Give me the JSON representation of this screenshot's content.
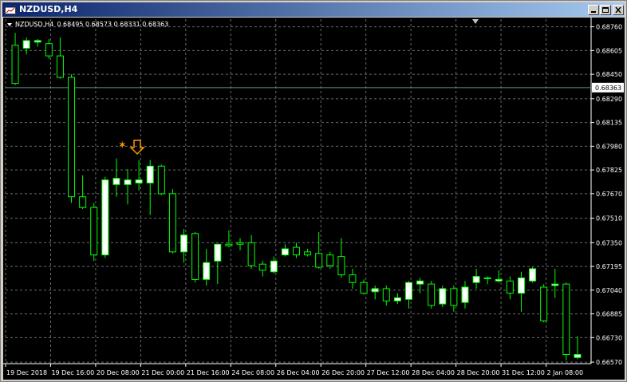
{
  "window": {
    "title": "NZDUSD,H4",
    "buttons": [
      "minimize",
      "restore",
      "close"
    ]
  },
  "header": {
    "symbol_timeframe": "NZDUSD,H4",
    "ohlc": "0.68495 0.68573 0.68331 0.68363"
  },
  "colors": {
    "background": "#000000",
    "grid": "#6b6b6b",
    "candle_up": "#ffffff",
    "candle_down": "#000000",
    "wick": "#00ff00",
    "price_line": "#5f8f8f",
    "arrow": "#ff9900",
    "axis_text": "#ffffff"
  },
  "chart_data": {
    "type": "candlestick",
    "symbol": "NZDUSD",
    "timeframe": "H4",
    "y_ticks": [
      "0.68760",
      "0.68605",
      "0.68450",
      "0.68290",
      "0.68135",
      "0.67980",
      "0.67825",
      "0.67670",
      "0.67510",
      "0.67350",
      "0.67195",
      "0.67040",
      "0.66885",
      "0.66730",
      "0.66570"
    ],
    "ylim": [
      0.6656,
      0.6881
    ],
    "current_price": "0.68363",
    "x_labels": [
      "19 Dec 2018",
      "19 Dec 16:00",
      "20 Dec 08:00",
      "21 Dec 00:00",
      "21 Dec 16:00",
      "24 Dec 08:00",
      "26 Dec 04:00",
      "26 Dec 20:00",
      "27 Dec 12:00",
      "28 Dec 04:00",
      "28 Dec 20:00",
      "31 Dec 12:00",
      "2 Jan 08:00"
    ],
    "candles": [
      {
        "o": 0.6864,
        "h": 0.6872,
        "l": 0.6838,
        "c": 0.6839
      },
      {
        "o": 0.6862,
        "h": 0.6869,
        "l": 0.6858,
        "c": 0.6867
      },
      {
        "o": 0.6866,
        "h": 0.6868,
        "l": 0.6863,
        "c": 0.6867
      },
      {
        "o": 0.6865,
        "h": 0.6868,
        "l": 0.6855,
        "c": 0.6857
      },
      {
        "o": 0.6857,
        "h": 0.6869,
        "l": 0.6842,
        "c": 0.6843
      },
      {
        "o": 0.6843,
        "h": 0.6845,
        "l": 0.6761,
        "c": 0.6765
      },
      {
        "o": 0.6765,
        "h": 0.6779,
        "l": 0.6757,
        "c": 0.6758
      },
      {
        "o": 0.6758,
        "h": 0.6761,
        "l": 0.6723,
        "c": 0.6727
      },
      {
        "o": 0.6727,
        "h": 0.6778,
        "l": 0.6725,
        "c": 0.6776
      },
      {
        "o": 0.6773,
        "h": 0.679,
        "l": 0.6765,
        "c": 0.6777
      },
      {
        "o": 0.6773,
        "h": 0.6783,
        "l": 0.676,
        "c": 0.6776
      },
      {
        "o": 0.6774,
        "h": 0.6789,
        "l": 0.6769,
        "c": 0.6776
      },
      {
        "o": 0.6774,
        "h": 0.6789,
        "l": 0.6753,
        "c": 0.6785
      },
      {
        "o": 0.6785,
        "h": 0.6786,
        "l": 0.6766,
        "c": 0.6767
      },
      {
        "o": 0.6767,
        "h": 0.677,
        "l": 0.6728,
        "c": 0.6729
      },
      {
        "o": 0.6729,
        "h": 0.6744,
        "l": 0.6722,
        "c": 0.674
      },
      {
        "o": 0.6741,
        "h": 0.6742,
        "l": 0.6709,
        "c": 0.6711
      },
      {
        "o": 0.6711,
        "h": 0.6731,
        "l": 0.6707,
        "c": 0.6722
      },
      {
        "o": 0.6723,
        "h": 0.6734,
        "l": 0.6708,
        "c": 0.6734
      },
      {
        "o": 0.6734,
        "h": 0.6743,
        "l": 0.6732,
        "c": 0.6733
      },
      {
        "o": 0.6735,
        "h": 0.6738,
        "l": 0.673,
        "c": 0.6734
      },
      {
        "o": 0.6735,
        "h": 0.674,
        "l": 0.6718,
        "c": 0.672
      },
      {
        "o": 0.6721,
        "h": 0.6723,
        "l": 0.6713,
        "c": 0.6717
      },
      {
        "o": 0.6716,
        "h": 0.6726,
        "l": 0.6715,
        "c": 0.6723
      },
      {
        "o": 0.6727,
        "h": 0.6734,
        "l": 0.6726,
        "c": 0.6731
      },
      {
        "o": 0.6732,
        "h": 0.6735,
        "l": 0.6725,
        "c": 0.6727
      },
      {
        "o": 0.6729,
        "h": 0.6731,
        "l": 0.6726,
        "c": 0.6727
      },
      {
        "o": 0.6728,
        "h": 0.6742,
        "l": 0.6718,
        "c": 0.6719
      },
      {
        "o": 0.6727,
        "h": 0.6729,
        "l": 0.6718,
        "c": 0.672
      },
      {
        "o": 0.6726,
        "h": 0.6738,
        "l": 0.6712,
        "c": 0.6714
      },
      {
        "o": 0.6714,
        "h": 0.6718,
        "l": 0.6705,
        "c": 0.6709
      },
      {
        "o": 0.6709,
        "h": 0.6711,
        "l": 0.6701,
        "c": 0.6702
      },
      {
        "o": 0.6703,
        "h": 0.6707,
        "l": 0.6698,
        "c": 0.6705
      },
      {
        "o": 0.6705,
        "h": 0.6707,
        "l": 0.6694,
        "c": 0.6697
      },
      {
        "o": 0.6697,
        "h": 0.6702,
        "l": 0.6695,
        "c": 0.6699
      },
      {
        "o": 0.6698,
        "h": 0.671,
        "l": 0.6692,
        "c": 0.6709
      },
      {
        "o": 0.6708,
        "h": 0.6712,
        "l": 0.6702,
        "c": 0.671
      },
      {
        "o": 0.6708,
        "h": 0.671,
        "l": 0.6692,
        "c": 0.6694
      },
      {
        "o": 0.6695,
        "h": 0.6707,
        "l": 0.6693,
        "c": 0.6705
      },
      {
        "o": 0.6705,
        "h": 0.6707,
        "l": 0.669,
        "c": 0.6694
      },
      {
        "o": 0.6696,
        "h": 0.671,
        "l": 0.6692,
        "c": 0.6706
      },
      {
        "o": 0.6709,
        "h": 0.6718,
        "l": 0.6705,
        "c": 0.6713
      },
      {
        "o": 0.6712,
        "h": 0.6713,
        "l": 0.6708,
        "c": 0.6712
      },
      {
        "o": 0.671,
        "h": 0.6717,
        "l": 0.6709,
        "c": 0.6711
      },
      {
        "o": 0.671,
        "h": 0.6713,
        "l": 0.6698,
        "c": 0.6702
      },
      {
        "o": 0.6702,
        "h": 0.6716,
        "l": 0.669,
        "c": 0.6712
      },
      {
        "o": 0.671,
        "h": 0.6719,
        "l": 0.6709,
        "c": 0.6718
      },
      {
        "o": 0.6706,
        "h": 0.6708,
        "l": 0.6683,
        "c": 0.6684
      },
      {
        "o": 0.6707,
        "h": 0.6718,
        "l": 0.6699,
        "c": 0.6708
      },
      {
        "o": 0.6708,
        "h": 0.6709,
        "l": 0.6658,
        "c": 0.6662
      },
      {
        "o": 0.666,
        "h": 0.6674,
        "l": 0.6659,
        "c": 0.6662
      }
    ]
  }
}
